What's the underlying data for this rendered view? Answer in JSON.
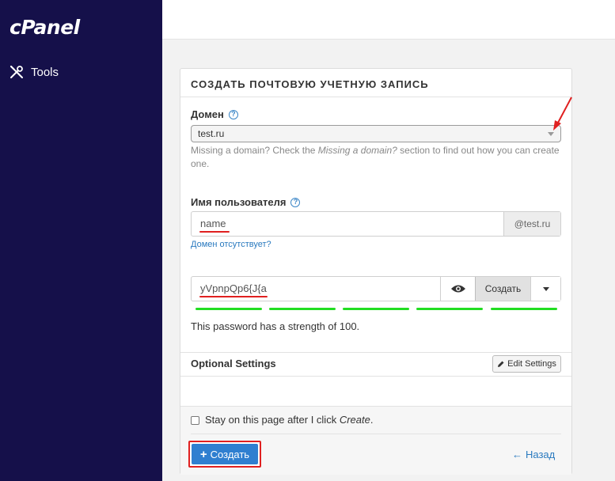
{
  "brand": {
    "logo": "cPanel"
  },
  "sidebar": {
    "items": [
      {
        "label": "Tools",
        "icon": "tools-icon"
      }
    ]
  },
  "card": {
    "title": "СОЗДАТЬ ПОЧТОВУЮ УЧЕТНУЮ ЗАПИСЬ",
    "domain": {
      "label": "Домен",
      "value": "test.ru",
      "hint_prefix": "Missing a domain? Check the ",
      "hint_em": "Missing a domain?",
      "hint_suffix": " section to find out how you can create one."
    },
    "username": {
      "label": "Имя пользователя",
      "value": "name",
      "suffix": "@test.ru",
      "missing_link": "Домен отсутствует?"
    },
    "password": {
      "value": "yVpnpQp6{J{a",
      "generate_label": "Создать",
      "strength_text": "This password has a strength of 100.",
      "strength_percent": 100
    },
    "optional": {
      "title": "Optional Settings",
      "edit_label": "Edit Settings"
    },
    "footer": {
      "stay_prefix": "Stay on this page after I click ",
      "stay_em": "Create",
      "stay_suffix": ".",
      "stay_checked": false,
      "create_label": "Создать",
      "back_label": "Назад"
    }
  },
  "colors": {
    "sidebar_bg": "#15104a",
    "primary_button": "#2f7fd0",
    "link": "#2a7abf",
    "strength_bar": "#22dd22",
    "highlight_red": "#e02020"
  }
}
